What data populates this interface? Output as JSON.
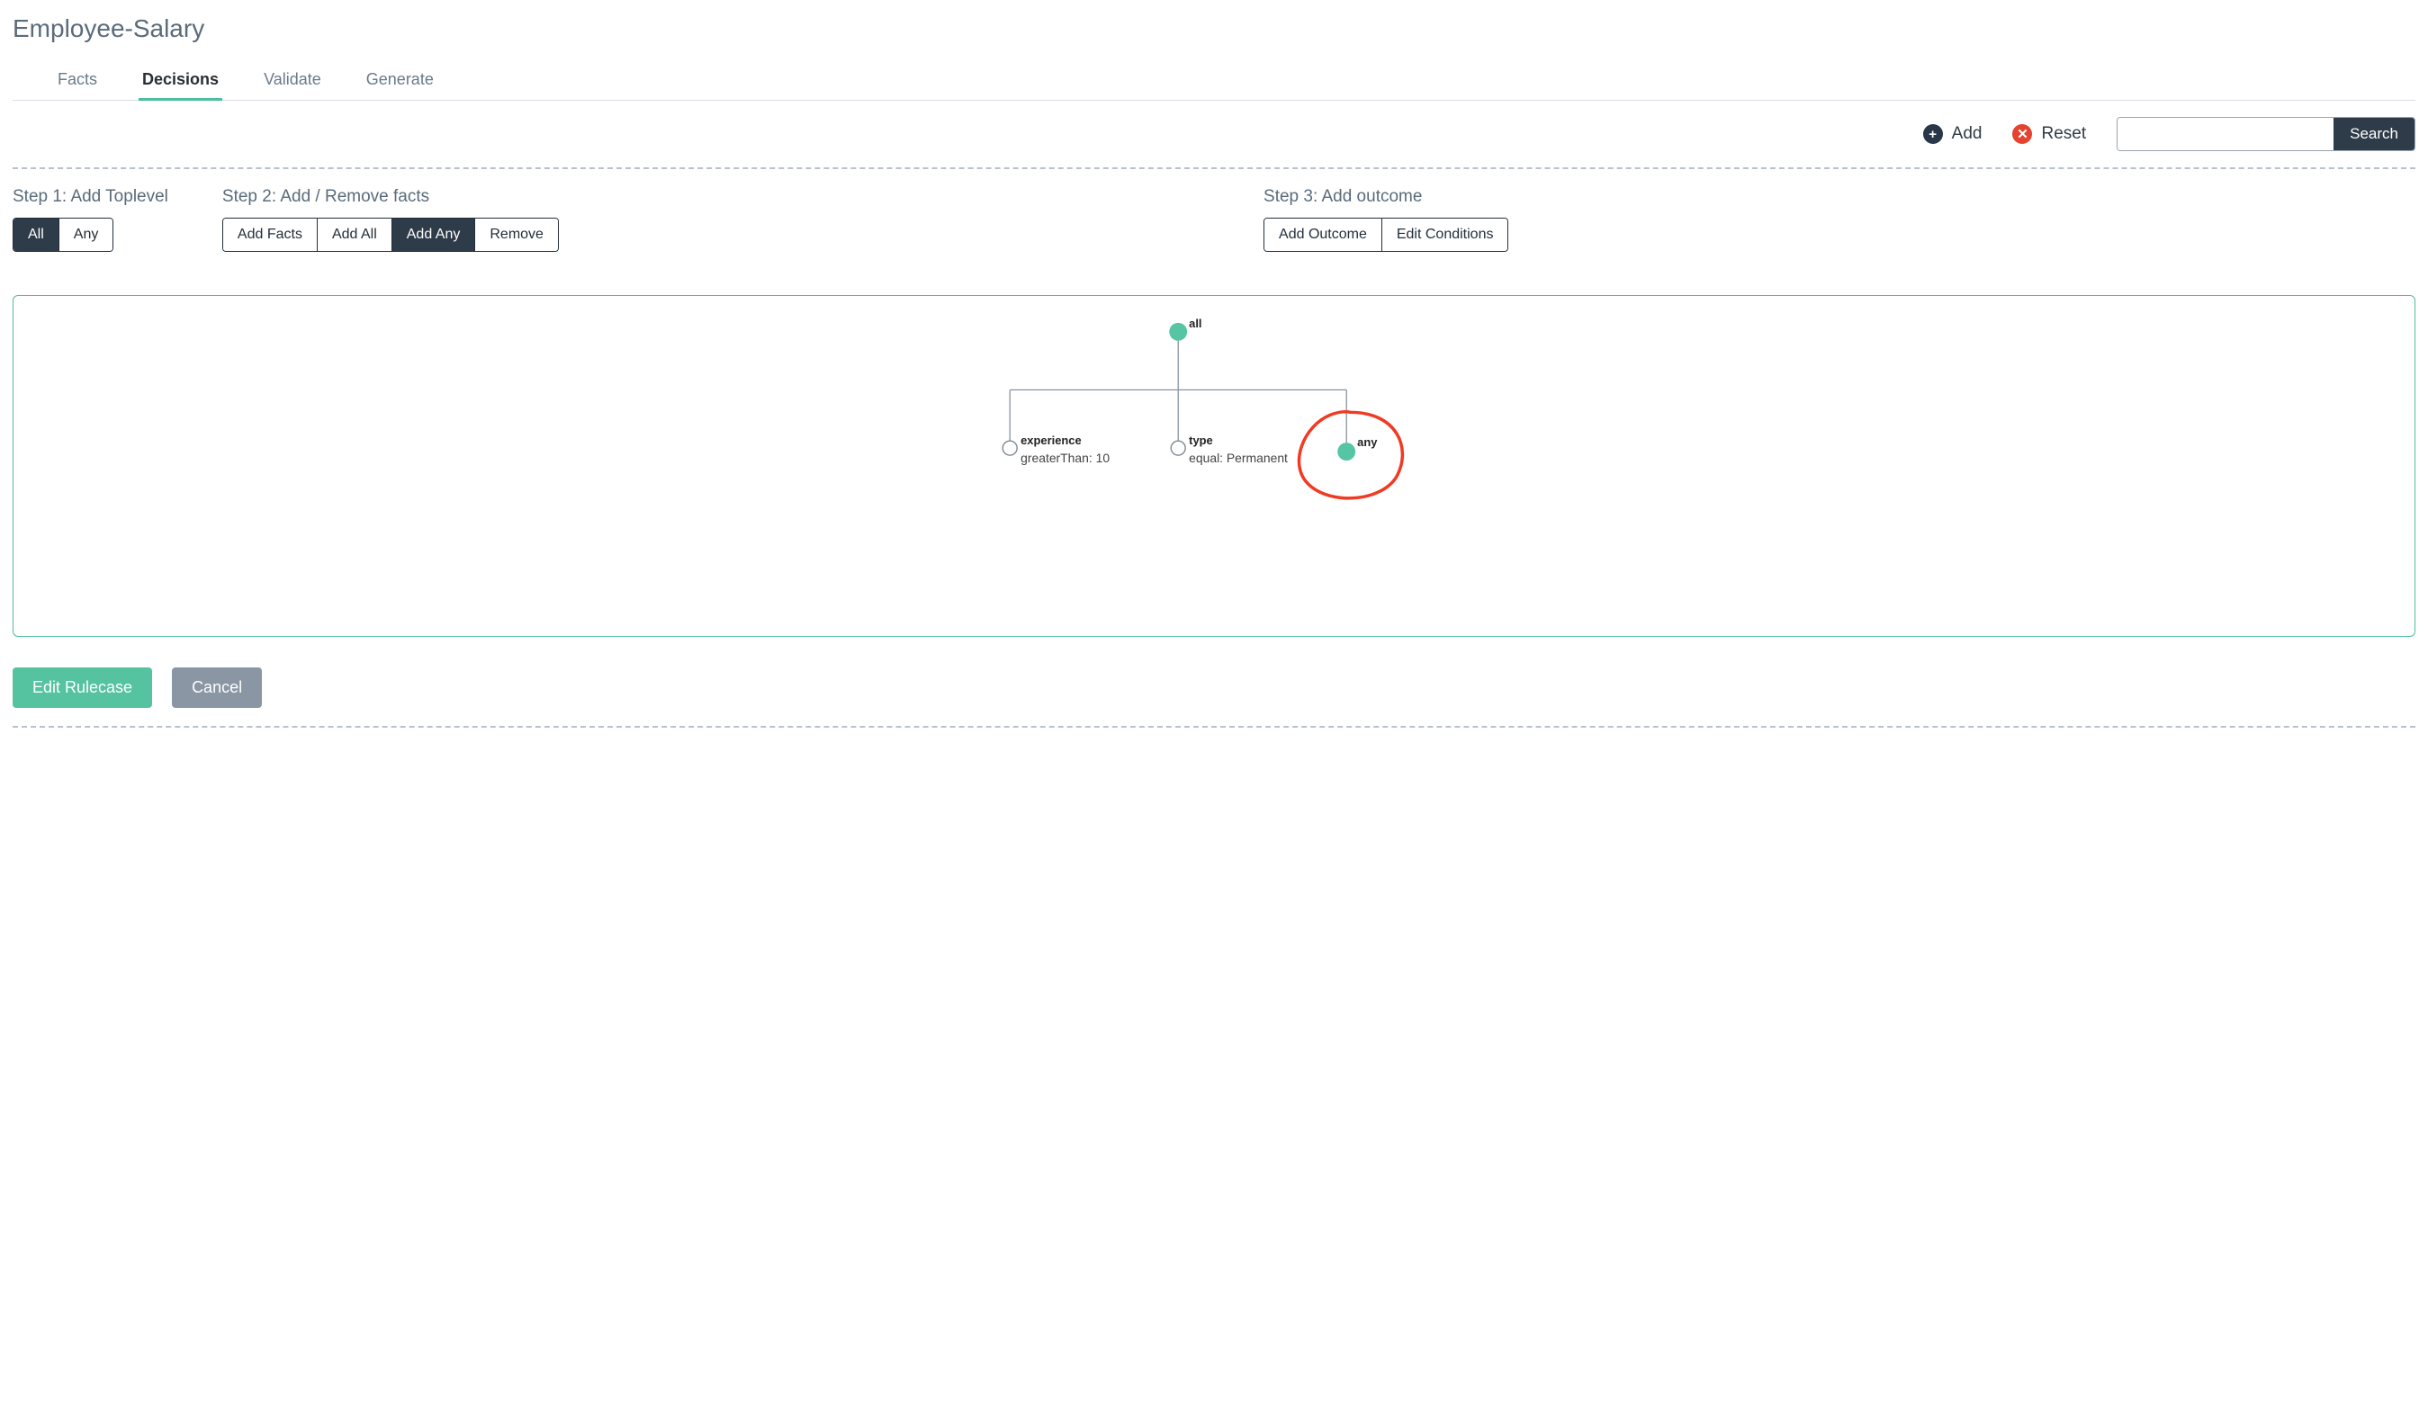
{
  "page_title": "Employee-Salary",
  "tabs": {
    "facts": {
      "label": "Facts",
      "active": false
    },
    "decisions": {
      "label": "Decisions",
      "active": true
    },
    "validate": {
      "label": "Validate",
      "active": false
    },
    "generate": {
      "label": "Generate",
      "active": false
    }
  },
  "toolbar": {
    "add_label": "Add",
    "reset_label": "Reset",
    "search_button": "Search",
    "search_value": ""
  },
  "steps": {
    "step1": {
      "title": "Step 1: Add Toplevel",
      "buttons": {
        "all": "All",
        "any": "Any"
      },
      "active": "all"
    },
    "step2": {
      "title": "Step 2: Add / Remove facts",
      "buttons": {
        "add_facts": "Add Facts",
        "add_all": "Add All",
        "add_any": "Add Any",
        "remove": "Remove"
      },
      "active": "add_any"
    },
    "step3": {
      "title": "Step 3: Add outcome",
      "buttons": {
        "add_outcome": "Add Outcome",
        "edit_conditions": "Edit Conditions"
      },
      "active": null
    }
  },
  "tree": {
    "colors": {
      "group_node": "#56c5a3",
      "fact_node_fill": "#ffffff",
      "fact_node_stroke": "#7d8a95",
      "line": "#7d8a95",
      "highlight": "#ef3b24"
    },
    "root": {
      "type": "group",
      "label": "all"
    },
    "children": [
      {
        "type": "fact",
        "label": "experience",
        "sub": "greaterThan: 10"
      },
      {
        "type": "fact",
        "label": "type",
        "sub": "equal: Permanent"
      },
      {
        "type": "group",
        "label": "any",
        "highlighted": true
      }
    ]
  },
  "footer": {
    "edit_rulecase": "Edit Rulecase",
    "cancel": "Cancel"
  }
}
